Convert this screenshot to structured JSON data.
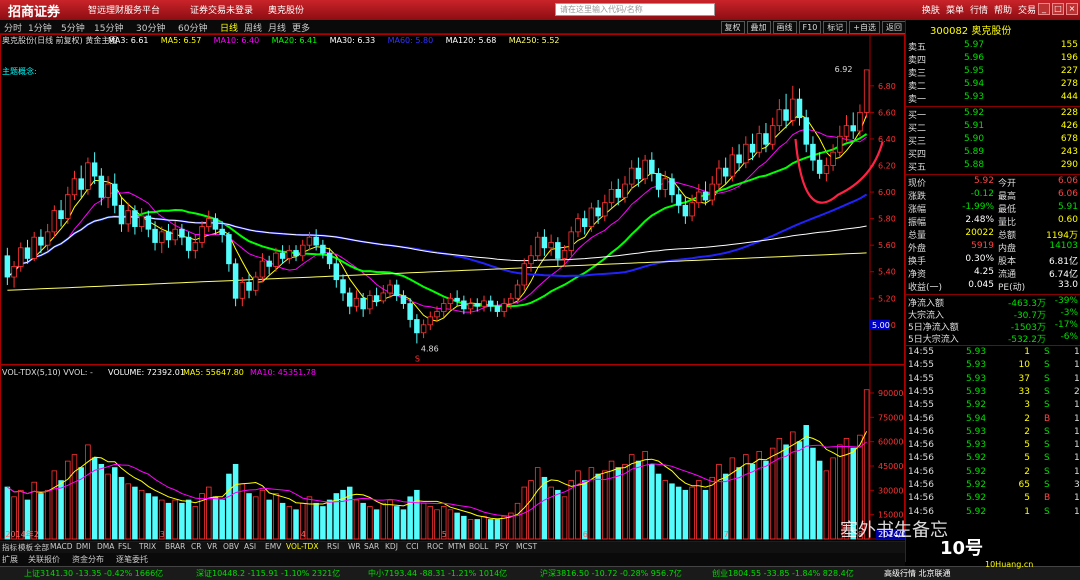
{
  "titlebar": {
    "brand": "招商证券",
    "subtitle": "智远理财服务平台",
    "market": "证券交易未登录",
    "stock": "奥克股份",
    "buttons": [
      "换肤",
      "菜单",
      "行情",
      "帮助",
      "交易"
    ]
  },
  "toolbar": {
    "periods": [
      "分时",
      "1分钟",
      "5分钟",
      "15分钟",
      "30分钟",
      "60分钟",
      "日线",
      "周线",
      "月线",
      "更多"
    ],
    "active": "日线",
    "tools": [
      "复权",
      "叠加",
      "画线",
      "F10",
      "标记",
      "+自选",
      "返回"
    ]
  },
  "header": {
    "stock_line": "奥克股份(日线 前复权) 黄金主图",
    "mas": [
      {
        "label": "MA3: 6.61",
        "color": "#ffffff"
      },
      {
        "label": "MA5: 6.57",
        "color": "#ffff00"
      },
      {
        "label": "MA10: 6.40",
        "color": "#ff00ff"
      },
      {
        "label": "MA20: 6.41",
        "color": "#00ff00"
      },
      {
        "label": "MA30: 6.33",
        "color": "#ffffff"
      },
      {
        "label": "MA60: 5.80",
        "color": "#3333ff"
      },
      {
        "label": "MA120: 5.68",
        "color": "#ffffff"
      },
      {
        "label": "MA250: 5.52",
        "color": "#ffff66"
      }
    ],
    "concept": "主题概念:"
  },
  "vol_header": {
    "label": "VOL-TDX(5,10) VVOL: -",
    "volume": "VOLUME: 72392.01",
    "ma5": "MA5: 55647.80",
    "ma10": "MA10: 45351.78"
  },
  "chart_data": {
    "type": "candlestick",
    "price_ticks": [
      "6.80",
      "6.60",
      "6.40",
      "6.20",
      "6.00",
      "5.80",
      "5.60",
      "5.40",
      "5.20",
      "5.00"
    ],
    "price_tick_values": [
      6.8,
      6.6,
      6.4,
      6.2,
      6.0,
      5.8,
      5.6,
      5.4,
      5.2,
      5.0
    ],
    "price_ylim": [
      4.72,
      7.1
    ],
    "last_price_marker": "5.00",
    "high_label": "6.92",
    "low_label": "4.86",
    "s_label": "S",
    "vol_ticks": [
      "90000",
      "75000",
      "60000",
      "45000",
      "30000",
      "15000"
    ],
    "vol_tick_values": [
      90000,
      75000,
      60000,
      45000,
      30000,
      15000
    ],
    "vol_ylim": [
      0,
      98000
    ],
    "x_labels": [
      "2014年2",
      "3",
      "4",
      "5",
      "6",
      "7",
      "8",
      "2014/08/05/二"
    ],
    "x_label_index": [
      0,
      23,
      44,
      65,
      86,
      107,
      127,
      130
    ],
    "bars": [
      [
        5.52,
        5.36,
        5.58,
        5.3,
        32000
      ],
      [
        5.36,
        5.44,
        5.48,
        5.28,
        26000
      ],
      [
        5.44,
        5.58,
        5.62,
        5.4,
        30000
      ],
      [
        5.58,
        5.5,
        5.64,
        5.46,
        24000
      ],
      [
        5.5,
        5.66,
        5.7,
        5.48,
        35000
      ],
      [
        5.66,
        5.6,
        5.72,
        5.54,
        28000
      ],
      [
        5.6,
        5.7,
        5.76,
        5.56,
        30000
      ],
      [
        5.7,
        5.86,
        5.9,
        5.66,
        42000
      ],
      [
        5.86,
        5.8,
        5.94,
        5.74,
        36000
      ],
      [
        5.8,
        5.98,
        6.04,
        5.76,
        48000
      ],
      [
        5.98,
        6.1,
        6.16,
        5.94,
        52000
      ],
      [
        6.1,
        6.02,
        6.2,
        5.96,
        44000
      ],
      [
        6.02,
        6.22,
        6.26,
        5.98,
        58000
      ],
      [
        6.22,
        6.12,
        6.3,
        6.06,
        50000
      ],
      [
        6.12,
        5.96,
        6.18,
        5.9,
        46000
      ],
      [
        5.96,
        6.06,
        6.12,
        5.88,
        40000
      ],
      [
        6.06,
        5.9,
        6.14,
        5.84,
        44000
      ],
      [
        5.9,
        5.76,
        5.96,
        5.7,
        38000
      ],
      [
        5.76,
        5.86,
        5.92,
        5.7,
        34000
      ],
      [
        5.86,
        5.74,
        5.9,
        5.68,
        32000
      ],
      [
        5.74,
        5.82,
        5.88,
        5.7,
        30000
      ],
      [
        5.82,
        5.72,
        5.86,
        5.66,
        28000
      ],
      [
        5.72,
        5.62,
        5.78,
        5.56,
        26000
      ],
      [
        5.62,
        5.7,
        5.74,
        5.54,
        24000
      ],
      [
        5.7,
        5.64,
        5.76,
        5.58,
        22000
      ],
      [
        5.64,
        5.72,
        5.78,
        5.6,
        24000
      ],
      [
        5.72,
        5.66,
        5.76,
        5.6,
        22000
      ],
      [
        5.66,
        5.56,
        5.7,
        5.5,
        24000
      ],
      [
        5.56,
        5.62,
        5.68,
        5.5,
        20000
      ],
      [
        5.62,
        5.74,
        5.78,
        5.58,
        28000
      ],
      [
        5.74,
        5.8,
        5.86,
        5.7,
        32000
      ],
      [
        5.8,
        5.72,
        5.84,
        5.68,
        26000
      ],
      [
        5.72,
        5.68,
        5.78,
        5.62,
        24000
      ],
      [
        5.68,
        5.46,
        5.7,
        5.4,
        40000
      ],
      [
        5.46,
        5.2,
        5.5,
        5.14,
        46000
      ],
      [
        5.2,
        5.32,
        5.36,
        5.14,
        34000
      ],
      [
        5.32,
        5.26,
        5.38,
        5.2,
        28000
      ],
      [
        5.26,
        5.36,
        5.4,
        5.22,
        26000
      ],
      [
        5.36,
        5.48,
        5.54,
        5.32,
        30000
      ],
      [
        5.48,
        5.44,
        5.52,
        5.38,
        24000
      ],
      [
        5.44,
        5.54,
        5.58,
        5.4,
        28000
      ],
      [
        5.54,
        5.5,
        5.6,
        5.46,
        22000
      ],
      [
        5.5,
        5.56,
        5.6,
        5.46,
        20000
      ],
      [
        5.56,
        5.52,
        5.6,
        5.48,
        18000
      ],
      [
        5.52,
        5.6,
        5.64,
        5.48,
        22000
      ],
      [
        5.6,
        5.66,
        5.7,
        5.56,
        26000
      ],
      [
        5.66,
        5.6,
        5.72,
        5.56,
        22000
      ],
      [
        5.6,
        5.54,
        5.64,
        5.5,
        20000
      ],
      [
        5.54,
        5.46,
        5.58,
        5.42,
        24000
      ],
      [
        5.46,
        5.34,
        5.5,
        5.28,
        28000
      ],
      [
        5.34,
        5.24,
        5.38,
        5.18,
        30000
      ],
      [
        5.24,
        5.14,
        5.28,
        5.08,
        32000
      ],
      [
        5.14,
        5.2,
        5.26,
        5.1,
        24000
      ],
      [
        5.2,
        5.12,
        5.24,
        5.06,
        22000
      ],
      [
        5.12,
        5.22,
        5.26,
        5.08,
        20000
      ],
      [
        5.22,
        5.18,
        5.28,
        5.14,
        18000
      ],
      [
        5.18,
        5.24,
        5.3,
        5.16,
        22000
      ],
      [
        5.24,
        5.3,
        5.34,
        5.2,
        24000
      ],
      [
        5.3,
        5.22,
        5.34,
        5.18,
        20000
      ],
      [
        5.22,
        5.16,
        5.26,
        5.12,
        18000
      ],
      [
        5.16,
        5.04,
        5.2,
        4.98,
        26000
      ],
      [
        5.04,
        4.94,
        5.08,
        4.86,
        30000
      ],
      [
        4.94,
        5.0,
        5.04,
        4.9,
        22000
      ],
      [
        5.0,
        5.06,
        5.1,
        4.96,
        20000
      ],
      [
        5.06,
        5.1,
        5.14,
        5.02,
        18000
      ],
      [
        5.1,
        5.16,
        5.2,
        5.06,
        20000
      ],
      [
        5.16,
        5.2,
        5.24,
        5.12,
        18000
      ],
      [
        5.2,
        5.18,
        5.26,
        5.14,
        16000
      ],
      [
        5.18,
        5.12,
        5.22,
        5.08,
        14000
      ],
      [
        5.12,
        5.16,
        5.2,
        5.08,
        12000
      ],
      [
        5.16,
        5.14,
        5.2,
        5.1,
        12000
      ],
      [
        5.14,
        5.18,
        5.22,
        5.1,
        14000
      ],
      [
        5.18,
        5.14,
        5.22,
        5.1,
        12000
      ],
      [
        5.14,
        5.1,
        5.18,
        5.06,
        12000
      ],
      [
        5.1,
        5.16,
        5.2,
        5.06,
        14000
      ],
      [
        5.16,
        5.2,
        5.24,
        5.12,
        16000
      ],
      [
        5.2,
        5.3,
        5.34,
        5.16,
        22000
      ],
      [
        5.3,
        5.46,
        5.5,
        5.26,
        32000
      ],
      [
        5.46,
        5.52,
        5.6,
        5.4,
        36000
      ],
      [
        5.52,
        5.66,
        5.7,
        5.48,
        44000
      ],
      [
        5.66,
        5.58,
        5.72,
        5.52,
        38000
      ],
      [
        5.58,
        5.62,
        5.68,
        5.52,
        32000
      ],
      [
        5.62,
        5.5,
        5.66,
        5.44,
        30000
      ],
      [
        5.5,
        5.56,
        5.6,
        5.44,
        26000
      ],
      [
        5.56,
        5.7,
        5.74,
        5.52,
        36000
      ],
      [
        5.7,
        5.8,
        5.84,
        5.66,
        42000
      ],
      [
        5.8,
        5.74,
        5.86,
        5.68,
        36000
      ],
      [
        5.74,
        5.88,
        5.92,
        5.7,
        44000
      ],
      [
        5.88,
        5.82,
        5.94,
        5.76,
        40000
      ],
      [
        5.82,
        5.92,
        5.98,
        5.78,
        42000
      ],
      [
        5.92,
        6.02,
        6.08,
        5.88,
        48000
      ],
      [
        6.02,
        5.96,
        6.1,
        5.9,
        44000
      ],
      [
        5.96,
        6.06,
        6.12,
        5.92,
        46000
      ],
      [
        6.06,
        6.18,
        6.24,
        6.02,
        52000
      ],
      [
        6.18,
        6.1,
        6.26,
        6.04,
        48000
      ],
      [
        6.1,
        6.24,
        6.28,
        6.06,
        54000
      ],
      [
        6.24,
        6.14,
        6.3,
        6.08,
        46000
      ],
      [
        6.14,
        6.02,
        6.18,
        5.96,
        40000
      ],
      [
        6.02,
        6.1,
        6.16,
        5.96,
        36000
      ],
      [
        6.1,
        5.98,
        6.14,
        5.92,
        34000
      ],
      [
        5.98,
        5.9,
        6.04,
        5.84,
        32000
      ],
      [
        5.9,
        5.82,
        5.96,
        5.76,
        30000
      ],
      [
        5.82,
        5.92,
        5.98,
        5.78,
        32000
      ],
      [
        5.92,
        6.0,
        6.06,
        5.88,
        36000
      ],
      [
        6.0,
        5.94,
        6.08,
        5.9,
        30000
      ],
      [
        5.94,
        6.06,
        6.12,
        5.9,
        38000
      ],
      [
        6.06,
        6.18,
        6.24,
        6.02,
        46000
      ],
      [
        6.18,
        6.12,
        6.26,
        6.06,
        40000
      ],
      [
        6.12,
        6.28,
        6.34,
        6.08,
        50000
      ],
      [
        6.28,
        6.22,
        6.36,
        6.16,
        44000
      ],
      [
        6.22,
        6.36,
        6.42,
        6.18,
        52000
      ],
      [
        6.36,
        6.3,
        6.44,
        6.24,
        46000
      ],
      [
        6.3,
        6.44,
        6.5,
        6.26,
        54000
      ],
      [
        6.44,
        6.36,
        6.52,
        6.3,
        48000
      ],
      [
        6.36,
        6.5,
        6.56,
        6.32,
        56000
      ],
      [
        6.5,
        6.62,
        6.7,
        6.46,
        62000
      ],
      [
        6.62,
        6.54,
        6.74,
        6.48,
        58000
      ],
      [
        6.54,
        6.7,
        6.8,
        6.5,
        66000
      ],
      [
        6.7,
        6.56,
        6.78,
        6.5,
        60000
      ],
      [
        6.56,
        6.36,
        6.62,
        6.3,
        70000
      ],
      [
        6.36,
        6.24,
        6.42,
        6.16,
        56000
      ],
      [
        6.24,
        6.14,
        6.3,
        6.1,
        48000
      ],
      [
        6.14,
        6.2,
        6.26,
        6.08,
        42000
      ],
      [
        6.2,
        6.3,
        6.36,
        6.16,
        50000
      ],
      [
        6.3,
        6.42,
        6.5,
        6.26,
        58000
      ],
      [
        6.42,
        6.5,
        6.58,
        6.38,
        62000
      ],
      [
        6.5,
        6.46,
        6.6,
        6.4,
        56000
      ],
      [
        6.46,
        6.6,
        6.66,
        6.42,
        64000
      ],
      [
        6.6,
        6.92,
        6.92,
        6.56,
        92000
      ]
    ]
  },
  "quote": {
    "title": "300082 奥克股份",
    "asks": [
      {
        "label": "卖五",
        "price": "5.97",
        "vol": "155"
      },
      {
        "label": "卖四",
        "price": "5.96",
        "vol": "196"
      },
      {
        "label": "卖三",
        "price": "5.95",
        "vol": "227"
      },
      {
        "label": "卖二",
        "price": "5.94",
        "vol": "278"
      },
      {
        "label": "卖一",
        "price": "5.93",
        "vol": "444"
      }
    ],
    "bids": [
      {
        "label": "买一",
        "price": "5.92",
        "vol": "228"
      },
      {
        "label": "买二",
        "price": "5.91",
        "vol": "426"
      },
      {
        "label": "买三",
        "price": "5.90",
        "vol": "678"
      },
      {
        "label": "买四",
        "price": "5.89",
        "vol": "243"
      },
      {
        "label": "买五",
        "price": "5.88",
        "vol": "290"
      }
    ],
    "stats": [
      {
        "l1": "现价",
        "v1": "5.92",
        "c1": "#ff4444",
        "l2": "今开",
        "v2": "6.06",
        "c2": "#ff4444"
      },
      {
        "l1": "涨跌",
        "v1": "-0.12",
        "c1": "#00dd00",
        "l2": "最高",
        "v2": "6.06",
        "c2": "#ff4444"
      },
      {
        "l1": "涨幅",
        "v1": "-1.99%",
        "c1": "#00dd00",
        "l2": "最低",
        "v2": "5.91",
        "c2": "#00dd00"
      },
      {
        "l1": "振幅",
        "v1": "2.48%",
        "c1": "#ffffff",
        "l2": "量比",
        "v2": "0.60",
        "c2": "#ffff00"
      },
      {
        "l1": "总量",
        "v1": "20022",
        "c1": "#ffff00",
        "l2": "总额",
        "v2": "1194万",
        "c2": "#ffff00"
      },
      {
        "l1": "外盘",
        "v1": "5919",
        "c1": "#ff4444",
        "l2": "内盘",
        "v2": "14103",
        "c2": "#00dd00"
      },
      {
        "l1": "换手",
        "v1": "0.30%",
        "c1": "#ffffff",
        "l2": "股本",
        "v2": "6.81亿",
        "c2": "#ffffff"
      },
      {
        "l1": "净资",
        "v1": "4.25",
        "c1": "#ffffff",
        "l2": "流通",
        "v2": "6.74亿",
        "c2": "#ffffff"
      },
      {
        "l1": "收益(一)",
        "v1": "0.045",
        "c1": "#ffffff",
        "l2": "PE(动)",
        "v2": "33.0",
        "c2": "#ffffff"
      }
    ],
    "flows": [
      {
        "label": "净流入额",
        "v": "-463.3万",
        "p": "-39%"
      },
      {
        "label": "大宗流入",
        "v": "-30.7万",
        "p": "-3%"
      },
      {
        "label": "5日净流入额",
        "v": "-1503万",
        "p": "-17%"
      },
      {
        "label": "5日大宗流入",
        "v": "-532.2万",
        "p": "-6%"
      }
    ],
    "ticks": [
      {
        "t": "14:55",
        "p": "5.93",
        "v": "1",
        "s": "S",
        "n": "1",
        "c": "#00dd00"
      },
      {
        "t": "14:55",
        "p": "5.93",
        "v": "10",
        "s": "S",
        "n": "1",
        "c": "#00dd00"
      },
      {
        "t": "14:55",
        "p": "5.93",
        "v": "37",
        "s": "S",
        "n": "1",
        "c": "#00dd00"
      },
      {
        "t": "14:55",
        "p": "5.93",
        "v": "33",
        "s": "S",
        "n": "2",
        "c": "#00dd00"
      },
      {
        "t": "14:55",
        "p": "5.92",
        "v": "3",
        "s": "S",
        "n": "1",
        "c": "#00dd00"
      },
      {
        "t": "14:56",
        "p": "5.94",
        "v": "2",
        "s": "B",
        "n": "1",
        "c": "#ff4444"
      },
      {
        "t": "14:56",
        "p": "5.93",
        "v": "2",
        "s": "S",
        "n": "1",
        "c": "#00dd00"
      },
      {
        "t": "14:56",
        "p": "5.93",
        "v": "5",
        "s": "S",
        "n": "1",
        "c": "#00dd00"
      },
      {
        "t": "14:56",
        "p": "5.92",
        "v": "5",
        "s": "S",
        "n": "1",
        "c": "#00dd00"
      },
      {
        "t": "14:56",
        "p": "5.92",
        "v": "2",
        "s": "S",
        "n": "1",
        "c": "#00dd00"
      },
      {
        "t": "14:56",
        "p": "5.92",
        "v": "65",
        "s": "S",
        "n": "3",
        "c": "#00dd00"
      },
      {
        "t": "14:56",
        "p": "5.92",
        "v": "5",
        "s": "B",
        "n": "1",
        "c": "#ff4444"
      },
      {
        "t": "14:56",
        "p": "5.92",
        "v": "1",
        "s": "S",
        "n": "1",
        "c": "#00dd00"
      }
    ]
  },
  "indicator_tabs": [
    "指标",
    "模板",
    "全部",
    "MACD",
    "DMI",
    "DMA",
    "FSL",
    "TRIX",
    "BRAR",
    "CR",
    "VR",
    "OBV",
    "ASI",
    "EMV",
    "VOL-TDX",
    "RSI",
    "WR",
    "SAR",
    "KDJ",
    "CCI",
    "ROC",
    "MTM",
    "BOLL",
    "PSY",
    "MCST"
  ],
  "bottom_tabs": [
    "扩展",
    "关联报价",
    "资金分布",
    "逐笔委托"
  ],
  "status": [
    {
      "text": "上证3141.30 -13.35 -0.42% 1666亿",
      "color": "#00dd00"
    },
    {
      "text": "深证10448.2 -115.91 -1.10% 2321亿",
      "color": "#00dd00"
    },
    {
      "text": "中小7193.44 -88.31 -1.21% 1014亿",
      "color": "#00dd00"
    },
    {
      "text": "沪深3816.50 -10.72 -0.28% 956.7亿",
      "color": "#00dd00"
    },
    {
      "text": "创业1804.55 -33.85 -1.84% 828.4亿",
      "color": "#00dd00"
    },
    {
      "text": "高级行情 北京联通",
      "color": "#ffffff"
    }
  ],
  "watermark": {
    "text": "塞外书生备忘",
    "site": "10Huang.cn",
    "brand": "10号"
  },
  "colors": {
    "up": "#ff3333",
    "down": "#54fcfc",
    "ma5": "#ffff00",
    "ma10": "#ff00ff",
    "ma20": "#00ff00",
    "ma60": "#2222ff",
    "ma120": "#ffffff",
    "ma250": "#ffff66",
    "annot": "#ff2244"
  }
}
